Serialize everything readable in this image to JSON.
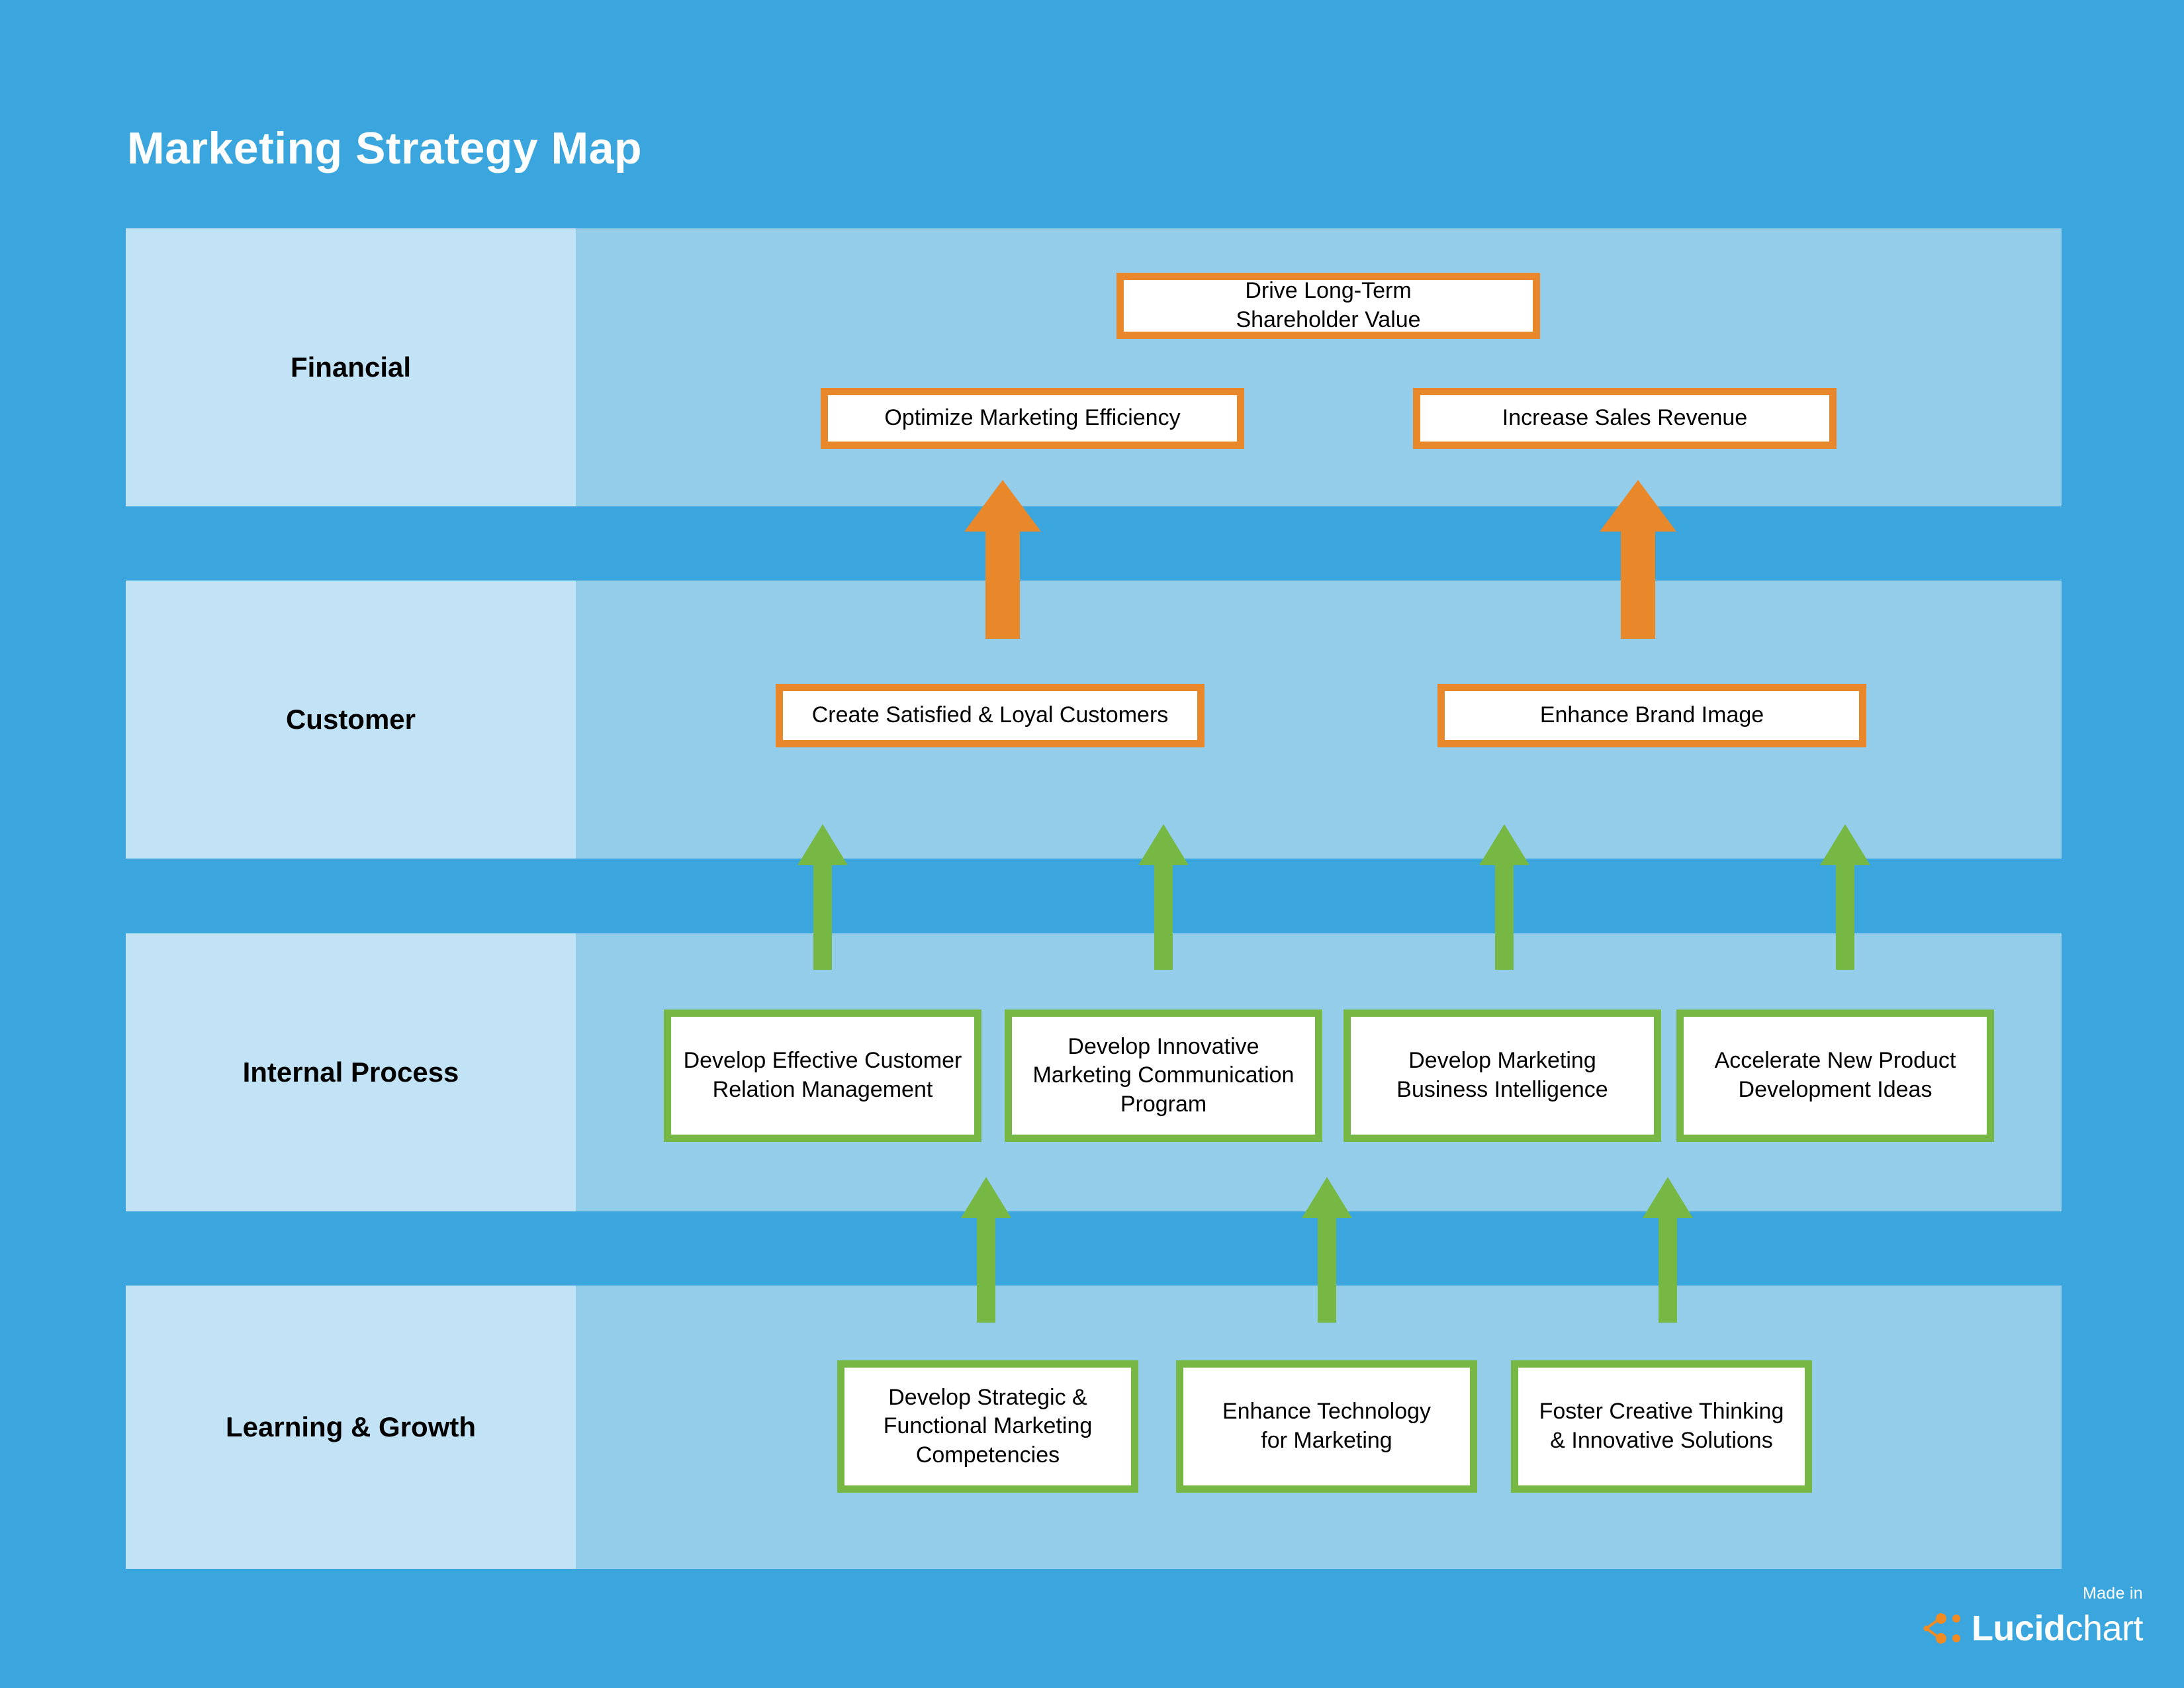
{
  "title": "Marketing Strategy Map",
  "colors": {
    "page_background": "#3aa6dd",
    "row_label_background": "#c2e2f5",
    "row_content_background": "#94cdea",
    "orange_accent": "#e8882a",
    "green_accent": "#76b843",
    "box_fill": "#ffffff",
    "text": "#000000",
    "title_text": "#ffffff"
  },
  "rows": [
    {
      "label": "Financial",
      "accent": "orange",
      "objectives": [
        {
          "text": "Drive Long-Term\nShareholder Value"
        },
        {
          "text": "Optimize Marketing Efficiency"
        },
        {
          "text": "Increase Sales Revenue"
        }
      ]
    },
    {
      "label": "Customer",
      "accent": "orange",
      "objectives": [
        {
          "text": "Create Satisfied & Loyal Customers"
        },
        {
          "text": "Enhance Brand Image"
        }
      ]
    },
    {
      "label": "Internal Process",
      "accent": "green",
      "objectives": [
        {
          "text": "Develop Effective Customer\nRelation Management"
        },
        {
          "text": "Develop Innovative\nMarketing Communication\nProgram"
        },
        {
          "text": "Develop Marketing\nBusiness Intelligence"
        },
        {
          "text": "Accelerate New Product\nDevelopment Ideas"
        }
      ]
    },
    {
      "label": "Learning & Growth",
      "accent": "green",
      "objectives": [
        {
          "text": "Develop Strategic &\nFunctional Marketing\nCompetencies"
        },
        {
          "text": "Enhance Technology\nfor Marketing"
        },
        {
          "text": "Foster Creative Thinking\n& Innovative Solutions"
        }
      ]
    }
  ],
  "arrows": [
    {
      "name": "arrow-customer-to-financial-left",
      "color": "#e8882a",
      "style": "thick"
    },
    {
      "name": "arrow-customer-to-financial-right",
      "color": "#e8882a",
      "style": "thick"
    },
    {
      "name": "arrow-internal-to-customer-1",
      "color": "#76b843",
      "style": "thin"
    },
    {
      "name": "arrow-internal-to-customer-2",
      "color": "#76b843",
      "style": "thin"
    },
    {
      "name": "arrow-internal-to-customer-3",
      "color": "#76b843",
      "style": "thin"
    },
    {
      "name": "arrow-internal-to-customer-4",
      "color": "#76b843",
      "style": "thin"
    },
    {
      "name": "arrow-learning-to-internal-1",
      "color": "#76b843",
      "style": "thin"
    },
    {
      "name": "arrow-learning-to-internal-2",
      "color": "#76b843",
      "style": "thin"
    },
    {
      "name": "arrow-learning-to-internal-3",
      "color": "#76b843",
      "style": "thin"
    }
  ],
  "footer": {
    "made_in": "Made in",
    "brand_bold": "Lucid",
    "brand_light": "chart",
    "logo_color": "#f08a22"
  }
}
